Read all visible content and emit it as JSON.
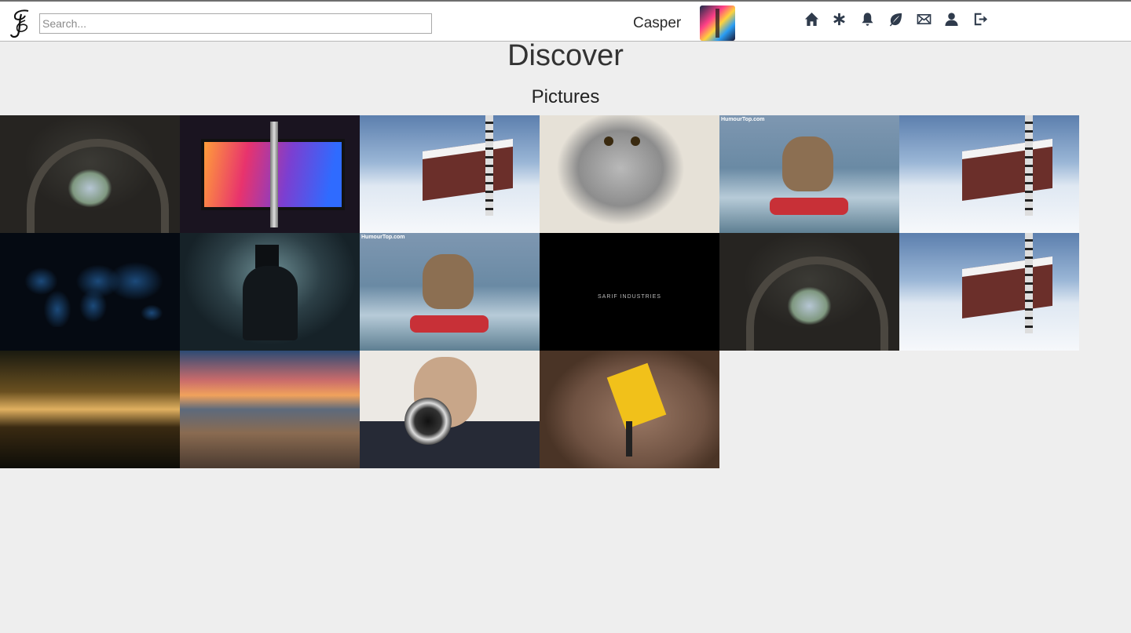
{
  "header": {
    "search_placeholder": "Search...",
    "username": "Casper",
    "nav": [
      {
        "name": "home",
        "icon": "home-icon"
      },
      {
        "name": "discover",
        "icon": "asterisk-icon"
      },
      {
        "name": "notifications",
        "icon": "bell-icon"
      },
      {
        "name": "posts",
        "icon": "leaf-icon"
      },
      {
        "name": "messages",
        "icon": "envelope-icon"
      },
      {
        "name": "profile",
        "icon": "user-icon"
      },
      {
        "name": "logout",
        "icon": "logout-icon"
      }
    ],
    "icon_color": "#2f3b4c"
  },
  "main": {
    "title": "Discover",
    "subtitle": "Pictures",
    "pictures": [
      {
        "subject": "abandoned arch hall"
      },
      {
        "subject": "laptop with vape pen"
      },
      {
        "subject": "snowy cabin"
      },
      {
        "subject": "surprised cat"
      },
      {
        "subject": "dog on jet ski",
        "watermark": "HumourTop.com"
      },
      {
        "subject": "snowy cabin"
      },
      {
        "subject": "glowing world map"
      },
      {
        "subject": "man in top hat"
      },
      {
        "subject": "dog on jet ski",
        "watermark": "HumourTop.com"
      },
      {
        "subject": "black logo screen",
        "brand": "SARIF INDUSTRIES"
      },
      {
        "subject": "abandoned arch hall"
      },
      {
        "subject": "snowy cabin"
      },
      {
        "subject": "sunlit forest pond"
      },
      {
        "subject": "coastal sunset"
      },
      {
        "subject": "person with camera"
      },
      {
        "subject": "jackhammer"
      }
    ]
  }
}
